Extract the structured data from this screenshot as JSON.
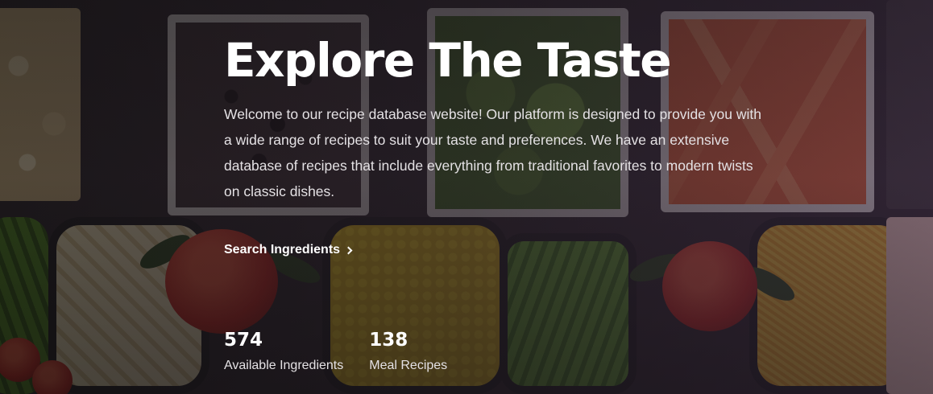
{
  "hero": {
    "title": "Explore The Taste",
    "description": "Welcome to our recipe database website! Our platform is designed to provide you with a wide range of recipes to suit your taste and preferences. We have an extensive database of recipes that include everything from traditional favorites to modern twists on classic dishes.",
    "cta_label": "Search Ingredients",
    "cta_icon": "chevron-right-icon"
  },
  "stats": [
    {
      "value": "574",
      "label": "Available Ingredients"
    },
    {
      "value": "138",
      "label": "Meal Recipes"
    }
  ],
  "colors": {
    "text": "#ffffff",
    "muted_text": "#e4e1e4",
    "overlay": "#2a1e2e"
  }
}
